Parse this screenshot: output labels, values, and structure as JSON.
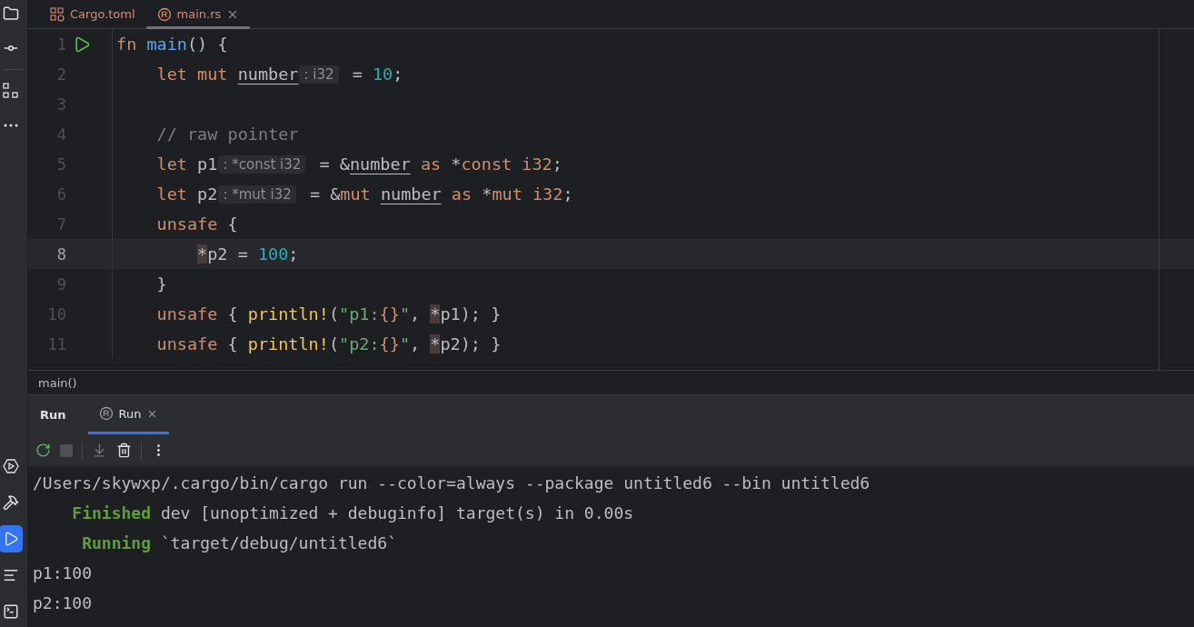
{
  "tool_strip": {
    "top": [
      {
        "kind": "project",
        "selected": false
      },
      {
        "kind": "commit",
        "selected": false
      },
      {
        "kind": "structure",
        "selected": false
      },
      {
        "kind": "more",
        "selected": false
      }
    ],
    "bottom": [
      {
        "kind": "services",
        "selected": false
      },
      {
        "kind": "build",
        "selected": false
      },
      {
        "kind": "run",
        "selected": true
      },
      {
        "kind": "problems",
        "selected": false
      },
      {
        "kind": "terminal",
        "selected": false
      }
    ]
  },
  "editor_tabs": [
    {
      "label": "Cargo.toml",
      "kind": "toml",
      "selected": false,
      "closable": false
    },
    {
      "label": "main.rs",
      "kind": "rust",
      "selected": true,
      "closable": true
    }
  ],
  "code_lines": [
    {
      "number": "1",
      "run_marker": true,
      "current": false,
      "tokens": [
        {
          "kind": "keyword",
          "text": "fn "
        },
        {
          "kind": "function",
          "text": "main"
        },
        {
          "kind": "plain",
          "text": "() {"
        }
      ],
      "children": [
        {
          "number": "2",
          "run_marker": false,
          "current": false,
          "tokens": [
            {
              "kind": "keyword",
              "text": "let mut "
            },
            {
              "kind": "variable",
              "text": "number"
            },
            {
              "kind": "hint",
              "text": ": i32"
            },
            {
              "kind": "plain",
              "text": " = "
            },
            {
              "kind": "number",
              "text": "10"
            },
            {
              "kind": "plain",
              "text": ";"
            }
          ]
        },
        {
          "number": "3",
          "run_marker": false,
          "current": false
        },
        {
          "number": "4",
          "run_marker": false,
          "current": false,
          "tokens": [
            {
              "kind": "comment",
              "text": "// raw pointer"
            }
          ]
        },
        {
          "number": "5",
          "run_marker": false,
          "current": false,
          "tokens": [
            {
              "kind": "keyword",
              "text": "let "
            },
            {
              "kind": "plain",
              "text": "p1"
            },
            {
              "kind": "hint",
              "text": ": *const i32"
            },
            {
              "kind": "plain",
              "text": " = &"
            },
            {
              "kind": "variable",
              "text": "number"
            },
            {
              "kind": "keyword",
              "text": " as "
            },
            {
              "kind": "plain",
              "text": "*"
            },
            {
              "kind": "keyword",
              "text": "const i32"
            },
            {
              "kind": "plain",
              "text": ";"
            }
          ]
        },
        {
          "number": "6",
          "run_marker": false,
          "current": false,
          "tokens": [
            {
              "kind": "keyword",
              "text": "let "
            },
            {
              "kind": "plain",
              "text": "p2"
            },
            {
              "kind": "hint",
              "text": ": *mut i32"
            },
            {
              "kind": "plain",
              "text": " = &"
            },
            {
              "kind": "keyword",
              "text": "mut "
            },
            {
              "kind": "variable",
              "text": "number"
            },
            {
              "kind": "keyword",
              "text": " as "
            },
            {
              "kind": "plain",
              "text": "*"
            },
            {
              "kind": "keyword",
              "text": "mut i32"
            },
            {
              "kind": "plain",
              "text": ";"
            }
          ]
        },
        {
          "number": "7",
          "run_marker": false,
          "current": false,
          "tokens": [
            {
              "kind": "keyword",
              "text": "unsafe"
            },
            {
              "kind": "plain",
              "text": " {"
            }
          ],
          "children": [
            {
              "number": "8",
              "run_marker": false,
              "current": true,
              "tokens": [
                {
                  "kind": "deref",
                  "text": "*"
                },
                {
                  "kind": "plain",
                  "text": "p2 = "
                },
                {
                  "kind": "number",
                  "text": "100"
                },
                {
                  "kind": "plain",
                  "text": ";"
                }
              ]
            }
          ]
        },
        {
          "number": "9",
          "run_marker": false,
          "current": false,
          "tokens": [
            {
              "kind": "plain",
              "text": "}"
            }
          ]
        },
        {
          "number": "10",
          "run_marker": false,
          "current": false,
          "tokens": [
            {
              "kind": "keyword",
              "text": "unsafe"
            },
            {
              "kind": "plain",
              "text": " { "
            },
            {
              "kind": "macro",
              "text": "println!"
            },
            {
              "kind": "plain",
              "text": "("
            },
            {
              "kind": "string",
              "text": "\"p1:"
            },
            {
              "kind": "format",
              "text": "{}"
            },
            {
              "kind": "string",
              "text": "\""
            },
            {
              "kind": "plain",
              "text": ", "
            },
            {
              "kind": "deref",
              "text": "*"
            },
            {
              "kind": "plain",
              "text": "p1); }"
            }
          ]
        },
        {
          "number": "11",
          "run_marker": false,
          "current": false,
          "tokens": [
            {
              "kind": "keyword",
              "text": "unsafe"
            },
            {
              "kind": "plain",
              "text": " { "
            },
            {
              "kind": "macro",
              "text": "println!"
            },
            {
              "kind": "plain",
              "text": "("
            },
            {
              "kind": "string",
              "text": "\"p2:"
            },
            {
              "kind": "format",
              "text": "{}"
            },
            {
              "kind": "string",
              "text": "\""
            },
            {
              "kind": "plain",
              "text": ", "
            },
            {
              "kind": "deref",
              "text": "*"
            },
            {
              "kind": "plain",
              "text": "p2); }"
            }
          ]
        }
      ]
    }
  ],
  "breadcrumb": "main()",
  "run_panel": {
    "title": "Run",
    "tabs": [
      {
        "label": "Run",
        "selected": true,
        "closable": true
      }
    ]
  },
  "console_lines": [
    {
      "segments": [
        {
          "kind": "plain",
          "text": "/Users/skywxp/.cargo/bin/cargo run --color=always --package untitled6 --bin untitled6"
        }
      ]
    },
    {
      "segments": [
        {
          "kind": "status",
          "text": "    Finished"
        },
        {
          "kind": "plain",
          "text": " dev [unoptimized + debuginfo] target(s) in 0.00s"
        }
      ]
    },
    {
      "segments": [
        {
          "kind": "status",
          "text": "     Running"
        },
        {
          "kind": "plain",
          "text": " `target/debug/untitled6`"
        }
      ]
    },
    {
      "segments": [
        {
          "kind": "plain",
          "text": "p1:100"
        }
      ]
    },
    {
      "segments": [
        {
          "kind": "plain",
          "text": "p2:100"
        }
      ]
    }
  ]
}
